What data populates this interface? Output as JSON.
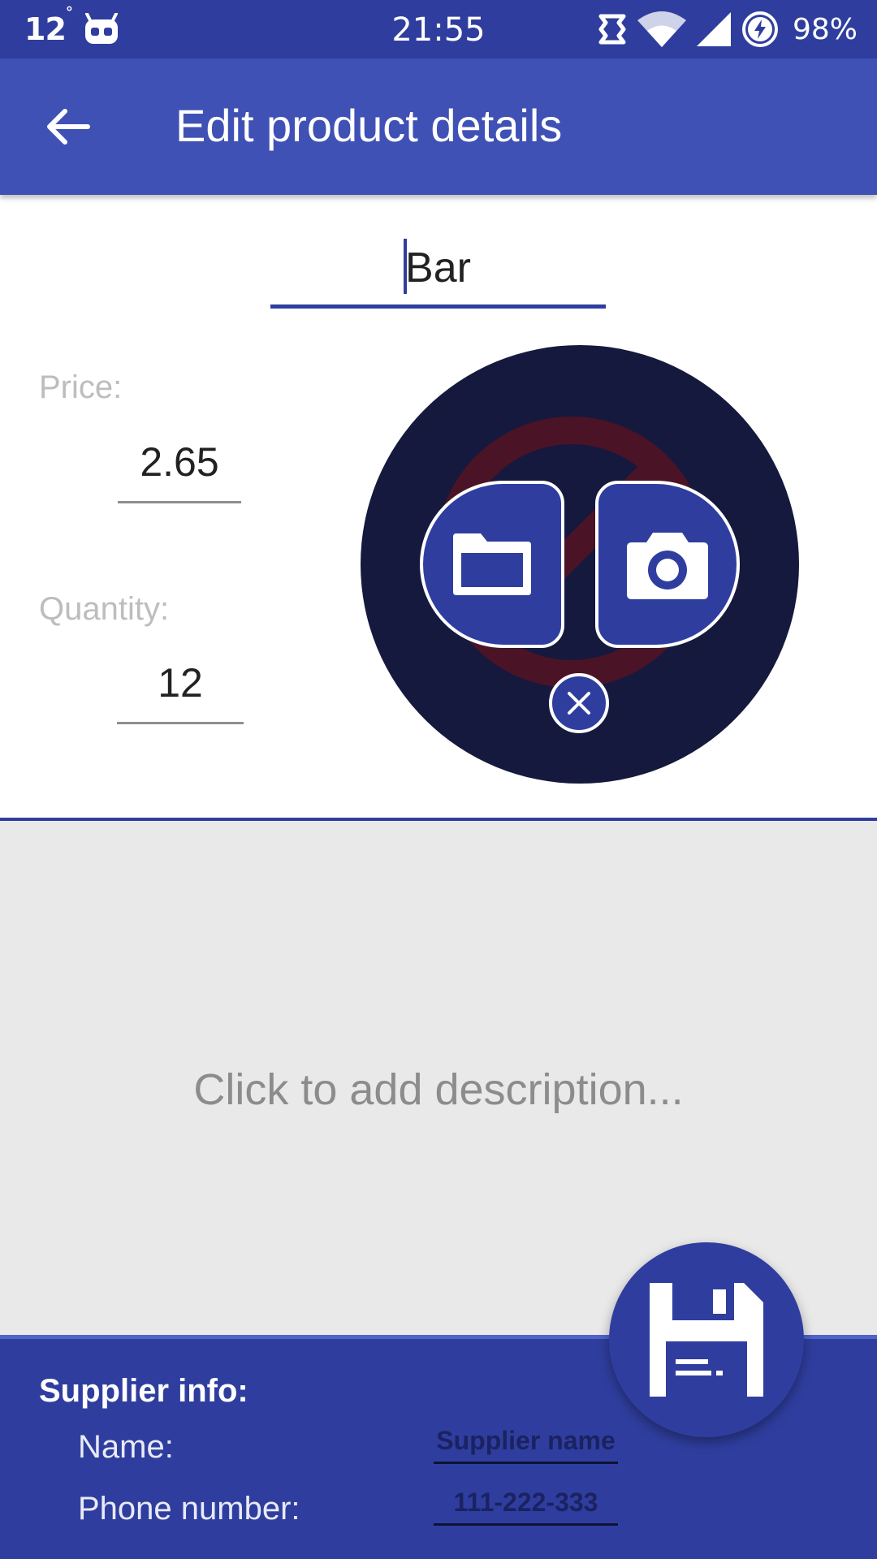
{
  "status_bar": {
    "temperature": "12",
    "degree": "°",
    "time": "21:55",
    "battery": "98%",
    "icons": [
      "weather-temp",
      "robot-icon",
      "sync-icon",
      "wifi-icon",
      "signal-icon",
      "battery-charging-icon"
    ]
  },
  "app_bar": {
    "title": "Edit product details",
    "back_icon": "arrow-left-icon"
  },
  "product": {
    "name": "Bar",
    "price_label": "Price:",
    "price": "2.65",
    "quantity_label": "Quantity:",
    "quantity": "12"
  },
  "image_picker": {
    "gallery_icon": "folder-icon",
    "camera_icon": "camera-icon",
    "close_icon": "close-icon",
    "placeholder_icon": "no-image-icon"
  },
  "description": {
    "placeholder": "Click to add description..."
  },
  "supplier": {
    "title": "Supplier info:",
    "name_label": "Name:",
    "name_placeholder": "Supplier name",
    "phone_label": "Phone number:",
    "phone_placeholder": "111-222-333"
  },
  "fab": {
    "icon": "save-floppy-icon"
  },
  "colors": {
    "primary": "#3f51b5",
    "primary_dark": "#2f3e9e",
    "circle_bg": "#15193d",
    "description_bg": "#e9e9e9"
  }
}
